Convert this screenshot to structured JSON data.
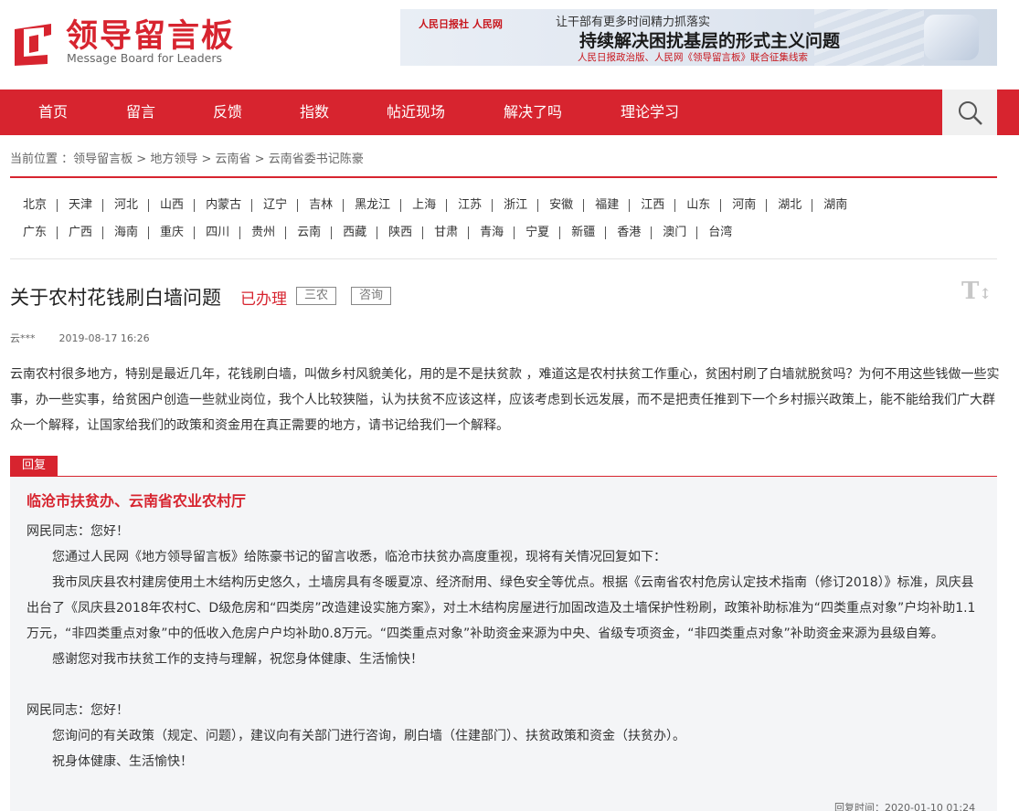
{
  "header": {
    "logo_cn": "领导留言板",
    "logo_en": "Message Board for Leaders",
    "banner": {
      "logos": "人民日报社  人民网",
      "top": "让干部有更多时间精力抓落实",
      "main": "持续解决困扰基层的形式主义问题",
      "sub": "人民日报政治版、人民网《领导留言板》联合征集线索"
    }
  },
  "nav": {
    "items": [
      "首页",
      "留言",
      "反馈",
      "指数",
      "帖近现场",
      "解决了吗",
      "理论学习"
    ],
    "search_icon": "search-icon"
  },
  "breadcrumb": {
    "prefix": "当前位置 ：",
    "items": [
      "领导留言板",
      "地方领导",
      "云南省",
      "云南省委书记陈豪"
    ],
    "sep": " > "
  },
  "regions": {
    "row1": [
      "北京",
      "天津",
      "河北",
      "山西",
      "内蒙古",
      "辽宁",
      "吉林",
      "黑龙江",
      "上海",
      "江苏",
      "浙江",
      "安徽",
      "福建",
      "江西",
      "山东",
      "河南",
      "湖北",
      "湖南"
    ],
    "row2": [
      "广东",
      "广西",
      "海南",
      "重庆",
      "四川",
      "贵州",
      "云南",
      "西藏",
      "陕西",
      "甘肃",
      "青海",
      "宁夏",
      "新疆",
      "香港",
      "澳门",
      "台湾"
    ]
  },
  "post": {
    "title": "关于农村花钱刷白墙问题",
    "status": "已办理",
    "tags": [
      "三农",
      "咨询"
    ],
    "font_toggle": "T",
    "author": "云***",
    "date": "2019-08-17 16:26",
    "content": "云南农村很多地方，特别是最近几年，花钱刷白墙，叫做乡村风貌美化，用的是不是扶贫款 ，难道这是农村扶贫工作重心，贫困村刷了白墙就脱贫吗？为何不用这些钱做一些实事，办一些实事，给贫困户创造一些就业岗位，我个人比较狭隘，认为扶贫不应该这样，应该考虑到长远发展，而不是把责任推到下一个乡村振兴政策上，能不能给我们广大群众一个解释，让国家给我们的政策和资金用在真正需要的地方，请书记给我们一个解释。"
  },
  "reply": {
    "badge": "回复",
    "org": "临沧市扶贫办、云南省农业农村厅",
    "p1": "网民同志：您好！",
    "p2": "您通过人民网《地方领导留言板》给陈豪书记的留言收悉，临沧市扶贫办高度重视，现将有关情况回复如下：",
    "p3": "我市凤庆县农村建房使用土木结构历史悠久，土墙房具有冬暖夏凉、经济耐用、绿色安全等优点。根据《云南省农村危房认定技术指南（修订2018）》标准，凤庆县出台了《凤庆县2018年农村C、D级危房和“四类房”改造建设实施方案》，对土木结构房屋进行加固改造及土墙保护性粉刷，政策补助标准为“四类重点对象”户均补助1.1万元，“非四类重点对象”中的低收入危房户户均补助0.8万元。“四类重点对象”补助资金来源为中央、省级专项资金，“非四类重点对象”补助资金来源为县级自筹。",
    "p4": "感谢您对我市扶贫工作的支持与理解，祝您身体健康、生活愉快！",
    "p5": "网民同志：您好！",
    "p6": "您询问的有关政策（规定、问题），建议向有关部门进行咨询，刷白墙（住建部门）、扶贫政策和资金（扶贫办）。",
    "p7": "祝身体健康、生活愉快！",
    "time_label": "回复时间：",
    "time": "2020-01-10 01:24"
  },
  "colors": {
    "brand_red": "#d7242f"
  }
}
